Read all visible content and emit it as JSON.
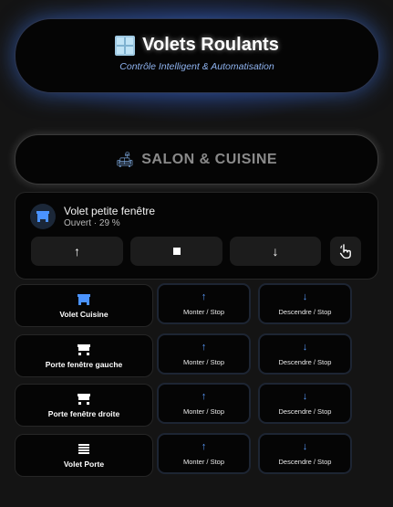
{
  "header": {
    "icon": "window-icon",
    "title": "Volets Roulants",
    "subtitle": "Contrôle Intelligent & Automatisation"
  },
  "section": {
    "icon": "sofa-lamp-icon",
    "title": "SALON & CUISINE"
  },
  "main_cover": {
    "icon": "shutter-icon",
    "name": "Volet petite fenêtre",
    "state": "Ouvert · 29 %",
    "position_percent": 29,
    "controls": {
      "up": "↑",
      "stop": "■",
      "down": "↓",
      "tap": "tap-finger-icon"
    }
  },
  "covers": [
    {
      "name": "Volet Cuisine",
      "icon": "shutter-icon",
      "icon_color": "#4a93ff",
      "up_label": "Monter / Stop",
      "down_label": "Descendre / Stop"
    },
    {
      "name": "Porte fenêtre gauche",
      "icon": "shutter-icon",
      "icon_color": "#ffffff",
      "up_label": "Monter / Stop",
      "down_label": "Descendre / Stop"
    },
    {
      "name": "Porte fenêtre droite",
      "icon": "shutter-icon",
      "icon_color": "#ffffff",
      "up_label": "Monter / Stop",
      "down_label": "Descendre / Stop"
    },
    {
      "name": "Volet Porte",
      "icon": "blinds-icon",
      "icon_color": "#ffffff",
      "up_label": "Monter / Stop",
      "down_label": "Descendre / Stop"
    }
  ],
  "arrows": {
    "up": "↑",
    "down": "↓"
  },
  "colors": {
    "accent": "#4a93ff",
    "glow": "#4682ff",
    "background": "#141414",
    "card": "#050505"
  }
}
